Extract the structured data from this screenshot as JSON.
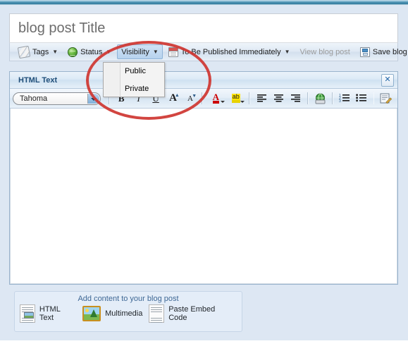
{
  "theme": {
    "accent_bar_color": "#3e88a9",
    "page_background": "#dde7f3",
    "panel_title_color": "#1f4e79",
    "annotation_color": "#cf3731"
  },
  "title_field": {
    "value": "blog post Title",
    "placeholder": "blog post Title"
  },
  "action_toolbar": {
    "items": [
      {
        "label": "Tags",
        "icon": "tag-icon",
        "has_caret": true,
        "state": "normal"
      },
      {
        "label": "Status",
        "icon": "globe-icon",
        "has_caret": true,
        "state": "normal"
      },
      {
        "label": "Visibility",
        "icon": "",
        "has_caret": true,
        "state": "active"
      },
      {
        "label": "To Be Published Immediately",
        "icon": "calendar-icon",
        "has_caret": true,
        "state": "normal"
      },
      {
        "label": "View blog post",
        "icon": "",
        "has_caret": false,
        "state": "disabled"
      },
      {
        "label": "Save blog post",
        "icon": "save-icon",
        "has_caret": false,
        "state": "normal"
      }
    ]
  },
  "visibility_menu": {
    "open": true,
    "items": [
      {
        "label": "Public"
      },
      {
        "label": "Private"
      }
    ]
  },
  "editor_panel": {
    "title": "HTML Text",
    "close_label": "✕",
    "font_select": {
      "value": "Tahoma",
      "options": [
        "Tahoma"
      ]
    },
    "toolbar_buttons": [
      {
        "name": "bold-button",
        "glyph": "B",
        "style": "bold"
      },
      {
        "name": "italic-button",
        "glyph": "I",
        "style": "italic"
      },
      {
        "name": "underline-button",
        "glyph": "U",
        "style": "underline"
      },
      {
        "name": "grow-font-button",
        "glyph": "A",
        "style": "grow"
      },
      {
        "name": "shrink-font-button",
        "glyph": "A",
        "style": "shrink"
      },
      {
        "name": "font-color-button",
        "glyph": "A",
        "style": "fontcolor"
      },
      {
        "name": "highlight-color-button",
        "glyph": "ab",
        "style": "highlight"
      },
      {
        "name": "align-left-button",
        "glyph": "",
        "style": "align-left"
      },
      {
        "name": "align-center-button",
        "glyph": "",
        "style": "align-center"
      },
      {
        "name": "align-right-button",
        "glyph": "",
        "style": "align-right"
      },
      {
        "name": "insert-link-button",
        "glyph": "",
        "style": "globe"
      },
      {
        "name": "numbered-list-button",
        "glyph": "",
        "style": "ol"
      },
      {
        "name": "bulleted-list-button",
        "glyph": "",
        "style": "ul"
      },
      {
        "name": "edit-source-button",
        "glyph": "",
        "style": "source"
      }
    ],
    "body_text": ""
  },
  "add_content": {
    "title": "Add content to your blog post",
    "options": [
      {
        "label": "HTML Text",
        "icon": "html-text-document-icon"
      },
      {
        "label": "Multimedia",
        "icon": "multimedia-image-icon"
      },
      {
        "label": "Paste Embed Code",
        "icon": "embed-code-document-icon"
      }
    ]
  }
}
